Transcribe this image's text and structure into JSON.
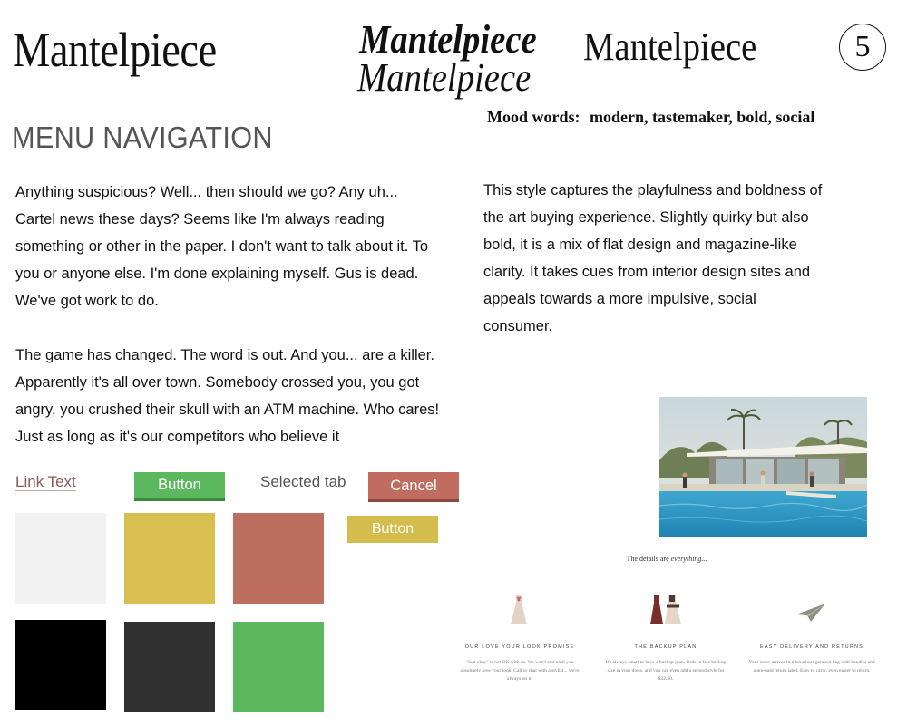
{
  "header": {
    "logo_main": "Mantelpiece",
    "logo_bold_italic": "Mantelpiece",
    "logo_regular": "Mantelpiece",
    "logo_italic": "Mantelpiece",
    "page_number": "5"
  },
  "section": {
    "title": "MENU NAVIGATION"
  },
  "mood": {
    "label": "Mood words:",
    "words": "modern, tastemaker, bold, social"
  },
  "copy_left": {
    "p1": "Anything suspicious? Well... then should we go? Any uh... Cartel news these days? Seems like I'm always reading something or other in the paper. I don't want to talk about it. To you or anyone else. I'm done explaining myself. Gus is dead. We've got work to do.",
    "p2": "The game has changed. The word is out. And you... are a killer. Apparently it's all over town. Somebody crossed you, you got angry, you crushed their skull with an ATM machine. Who cares! Just as long as it's our competitors who believe it"
  },
  "copy_right": {
    "p1": "This style captures the playfulness and boldness of the art buying experience. Slightly quirky but also bold, it is a mix of flat design and magazine-like clarity. It takes cues from interior design sites and appeals towards a more impulsive, social consumer."
  },
  "ui": {
    "link_text": "Link Text",
    "button_green": "Button",
    "selected_tab": "Selected tab",
    "button_cancel": "Cancel",
    "button_yellow": "Button"
  },
  "swatches": {
    "light_gray": "#f2f2f2",
    "mustard": "#d8bf4f",
    "terracotta": "#bc6e5f",
    "black": "#000000",
    "charcoal": "#303030",
    "green": "#5cb85f"
  },
  "details": {
    "title_prefix": "The details are",
    "title_emphasis": "everything...",
    "features": [
      {
        "title": "OUR LOVE YOUR LOOK PROMISE",
        "body": "\"Just okay\" is not OK with us. We won't rest until you absolutely love your look. Call or chat with a stylist... we're always on it."
      },
      {
        "title": "THE BACKUP PLAN",
        "body": "It's always smart to have a backup plan. Order a free backup size in your dress, and you can even add a second style for $32.50."
      },
      {
        "title": "EASY DELIVERY AND RETURNS",
        "body": "Your order arrives in a luxurious garment bag with handles and a pre-paid return label. Easy to carry, even easier to return."
      }
    ]
  }
}
